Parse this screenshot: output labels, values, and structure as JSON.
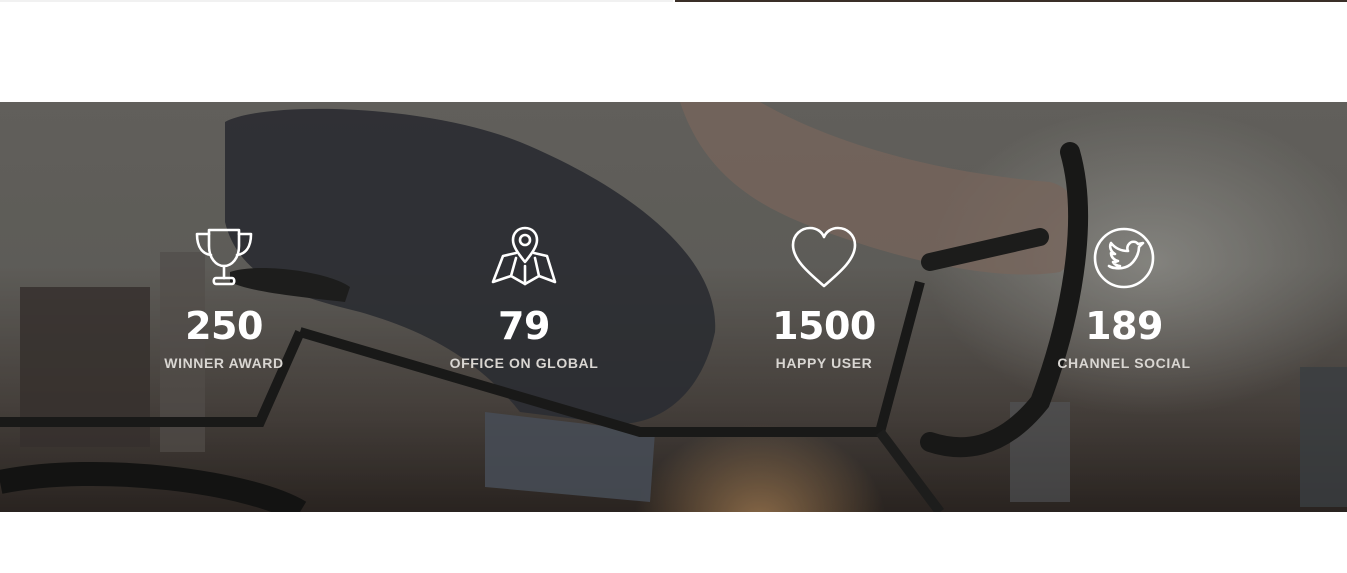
{
  "stats": [
    {
      "icon": "trophy-icon",
      "value": "250",
      "label": "WINNER AWARD"
    },
    {
      "icon": "map-pin-icon",
      "value": "79",
      "label": "OFFICE ON GLOBAL"
    },
    {
      "icon": "heart-icon",
      "value": "1500",
      "label": "HAPPY USER"
    },
    {
      "icon": "twitter-bird-icon",
      "value": "189",
      "label": "CHANNEL SOCIAL"
    }
  ],
  "colors": {
    "text": "#ffffff",
    "label": "#d9d6d2",
    "background_tint": "#6b6965"
  }
}
